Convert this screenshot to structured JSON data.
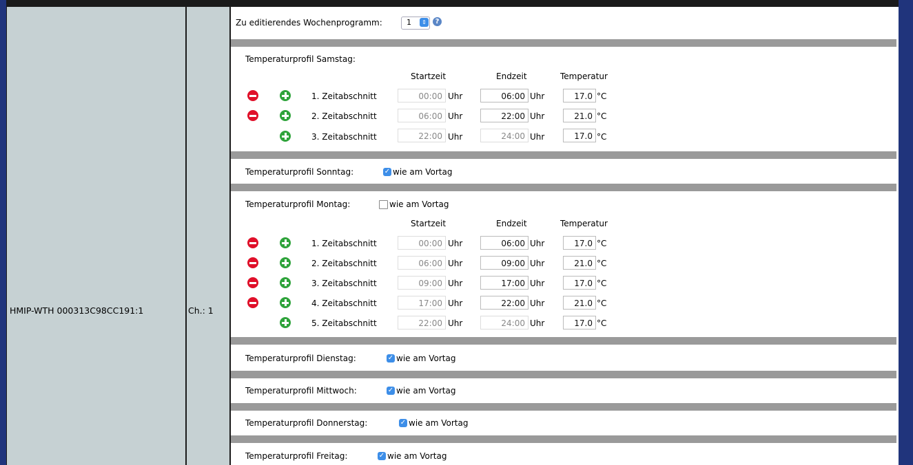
{
  "device": {
    "name": "HMIP-WTH 000313C98CC191:1",
    "channel": "Ch.: 1"
  },
  "program": {
    "label": "Zu editierendes Wochenprogramm:",
    "selected": "1"
  },
  "headers": {
    "start": "Startzeit",
    "end": "Endzeit",
    "temp": "Temperatur"
  },
  "unit_time": "Uhr",
  "unit_temp": "°C",
  "same_label": "wie am Vortag",
  "days": {
    "samstag": {
      "label": "Temperaturprofil Samstag:",
      "rows": [
        {
          "name": "1. Zeitabschnitt",
          "start": "00:00",
          "end": "06:00",
          "temp": "17.0"
        },
        {
          "name": "2. Zeitabschnitt",
          "start": "06:00",
          "end": "22:00",
          "temp": "21.0"
        },
        {
          "name": "3. Zeitabschnitt",
          "start": "22:00",
          "end": "24:00",
          "temp": "17.0"
        }
      ]
    },
    "sonntag": {
      "label": "Temperaturprofil Sonntag:",
      "same": true
    },
    "montag": {
      "label": "Temperaturprofil Montag:",
      "same": false,
      "rows": [
        {
          "name": "1. Zeitabschnitt",
          "start": "00:00",
          "end": "06:00",
          "temp": "17.0"
        },
        {
          "name": "2. Zeitabschnitt",
          "start": "06:00",
          "end": "09:00",
          "temp": "21.0"
        },
        {
          "name": "3. Zeitabschnitt",
          "start": "09:00",
          "end": "17:00",
          "temp": "17.0"
        },
        {
          "name": "4. Zeitabschnitt",
          "start": "17:00",
          "end": "22:00",
          "temp": "21.0"
        },
        {
          "name": "5. Zeitabschnitt",
          "start": "22:00",
          "end": "24:00",
          "temp": "17.0"
        }
      ]
    },
    "dienstag": {
      "label": "Temperaturprofil Dienstag:",
      "same": true
    },
    "mittwoch": {
      "label": "Temperaturprofil Mittwoch:",
      "same": true
    },
    "donnerstag": {
      "label": "Temperaturprofil Donnerstag:",
      "same": true
    },
    "freitag": {
      "label": "Temperaturprofil Freitag:",
      "same": true
    }
  }
}
